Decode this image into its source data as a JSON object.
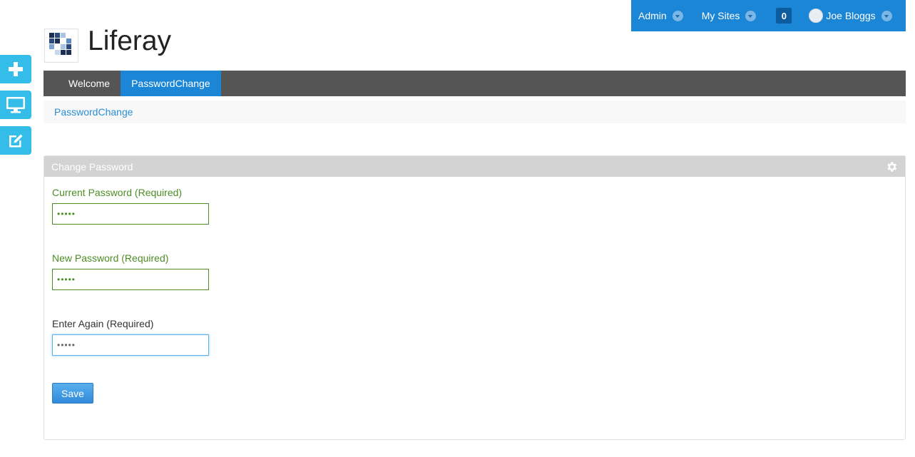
{
  "dockbar": {
    "admin_label": "Admin",
    "my_sites_label": "My Sites",
    "notification_count": "0",
    "user_name": "Joe Bloggs"
  },
  "site": {
    "name": "Liferay"
  },
  "nav": {
    "tabs": [
      {
        "label": "Welcome",
        "active": false
      },
      {
        "label": "PasswordChange",
        "active": true
      }
    ]
  },
  "breadcrumb": {
    "items": [
      "PasswordChange"
    ]
  },
  "portlet": {
    "title": "Change Password",
    "fields": [
      {
        "label": "Current Password (Required)",
        "value": "•••••"
      },
      {
        "label": "New Password (Required)",
        "value": "•••••"
      },
      {
        "label": "Enter Again (Required)",
        "value": "•••••"
      }
    ],
    "save_label": "Save"
  },
  "colors": {
    "dockbar": "#1c86d6",
    "nav_bar": "#555555",
    "active_tab": "#1c86d6",
    "rail_button": "#34bde9",
    "valid_field": "#4c8d25"
  },
  "icons": {
    "rail": [
      "plus-icon",
      "monitor-icon",
      "edit-icon"
    ],
    "portlet": "gear-icon"
  }
}
